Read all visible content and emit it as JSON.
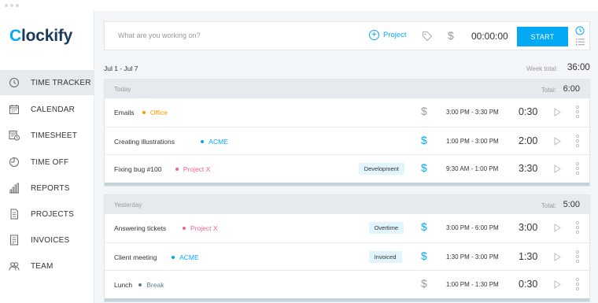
{
  "app": {
    "logo": {
      "first": "C",
      "rest": "lockify",
      "accent": "#03a9f4"
    }
  },
  "sidebar": {
    "items": [
      {
        "label": "TIME TRACKER",
        "icon": "clock-icon",
        "active": true
      },
      {
        "label": "CALENDAR",
        "icon": "calendar-icon",
        "active": false
      },
      {
        "label": "TIMESHEET",
        "icon": "timesheet-icon",
        "active": false
      },
      {
        "label": "TIME OFF",
        "icon": "time-off-icon",
        "active": false
      },
      {
        "label": "REPORTS",
        "icon": "bar-chart-icon",
        "active": false
      },
      {
        "label": "PROJECTS",
        "icon": "document-icon",
        "active": false
      },
      {
        "label": "INVOICES",
        "icon": "invoice-icon",
        "active": false
      },
      {
        "label": "TEAM",
        "icon": "team-icon",
        "active": false
      }
    ]
  },
  "tracker": {
    "placeholder": "What are you working on?",
    "project_label": "Project",
    "billable_symbol": "$",
    "timer": "00:00:00",
    "start_label": "START"
  },
  "week": {
    "range": "Jul 1 - Jul 7",
    "total_label": "Week total:",
    "total": "36:00"
  },
  "groups": [
    {
      "day": "Today",
      "total_label": "Total:",
      "total": "6:00",
      "entries": [
        {
          "name": "Emails",
          "project": "Office",
          "project_color": "#ff9800",
          "tag": "",
          "billable": false,
          "range": "3:00 PM - 3:30 PM",
          "duration": "0:30"
        },
        {
          "name": "Creating illustrations",
          "project": "ACME",
          "project_color": "#03a9f4",
          "tag": "",
          "billable": true,
          "range": "1:00 PM - 3:00 PM",
          "duration": "2:00"
        },
        {
          "name": "Fixing bug #100",
          "project": "Project X",
          "project_color": "#f06292",
          "tag": "Development",
          "billable": true,
          "range": "9:30 AM - 1:00 PM",
          "duration": "3:30"
        }
      ]
    },
    {
      "day": "Yesterday",
      "total_label": "Total:",
      "total": "5:00",
      "entries": [
        {
          "name": "Answering tickets",
          "project": "Project X",
          "project_color": "#f06292",
          "tag": "Overtime",
          "billable": true,
          "range": "3:00 PM - 6:00 PM",
          "duration": "3:00"
        },
        {
          "name": "Client meeting",
          "project": "ACME",
          "project_color": "#03a9f4",
          "tag": "Invoiced",
          "billable": true,
          "range": "1:30 PM - 3:00 PM",
          "duration": "1:30"
        },
        {
          "name": "Lunch",
          "project": "Break",
          "project_color": "#607d8b",
          "tag": "",
          "billable": false,
          "range": "1:00 PM - 1:30 PM",
          "duration": "0:30"
        }
      ]
    }
  ]
}
